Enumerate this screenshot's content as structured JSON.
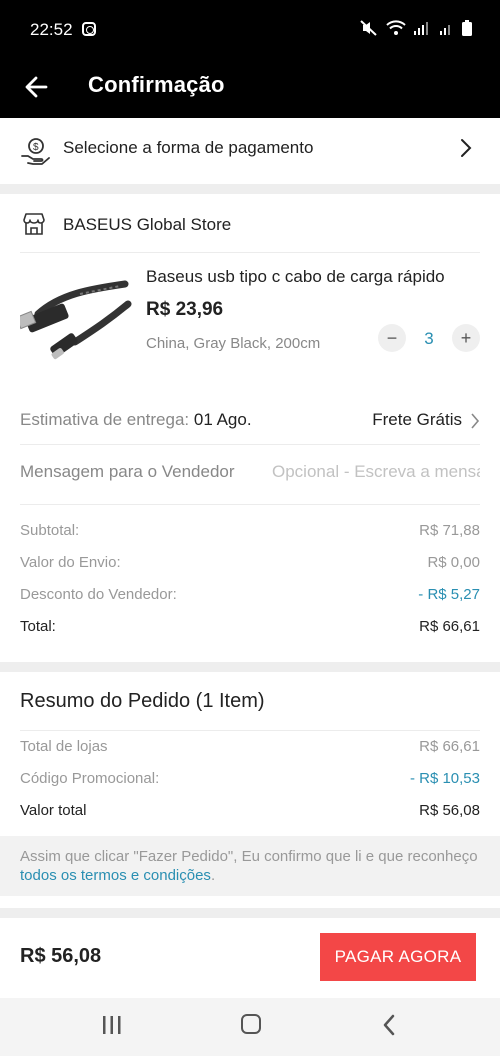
{
  "status_bar": {
    "time": "22:52"
  },
  "header": {
    "title": "Confirmação"
  },
  "payment": {
    "label": "Selecione a forma de pagamento"
  },
  "store": {
    "name": "BASEUS Global Store",
    "product": {
      "title": "Baseus usb tipo c cabo de carga rápido",
      "price": "R$ 23,96",
      "variant": "China, Gray Black, 200cm",
      "quantity": "3"
    },
    "delivery": {
      "label": "Estimativa de entrega:",
      "date": "01 Ago.",
      "shipping": "Frete Grátis"
    },
    "message": {
      "label": "Mensagem para o Vendedor",
      "placeholder": "Opcional - Escreva a mensagem"
    },
    "summary": {
      "subtotal_label": "Subtotal:",
      "subtotal_value": "R$ 71,88",
      "shipping_label": "Valor do Envio:",
      "shipping_value": "R$ 0,00",
      "discount_label": "Desconto do Vendedor:",
      "discount_value": "- R$ 5,27",
      "total_label": "Total:",
      "total_value": "R$ 66,61"
    }
  },
  "order_summary": {
    "title": "Resumo do Pedido (1 Item)",
    "stores_total_label": "Total de lojas",
    "stores_total_value": "R$ 66,61",
    "promo_label": "Código Promocional:",
    "promo_value": "- R$ 10,53",
    "grand_total_label": "Valor total",
    "grand_total_value": "R$ 56,08",
    "terms_text": "Assim que clicar \"Fazer Pedido\", Eu confirmo que li e que reconheço ",
    "terms_link": "todos os termos e condições",
    "terms_end": "."
  },
  "bottom": {
    "total": "R$ 56,08",
    "pay_button": "PAGAR AGORA"
  },
  "colors": {
    "accent": "#2a8fb2",
    "pay_button": "#f34747",
    "header_bg": "#000000"
  }
}
